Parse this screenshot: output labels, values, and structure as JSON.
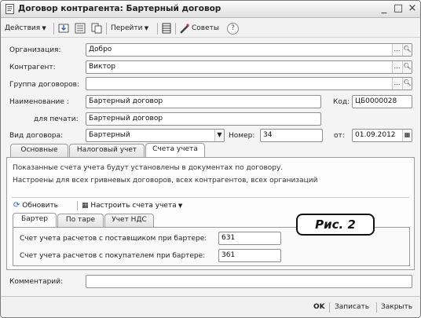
{
  "window": {
    "title": "Договор контрагента: Бартерный договор",
    "controls": {
      "minimize": "_",
      "maximize": "□",
      "close": "×"
    }
  },
  "toolbar": {
    "actions": "Действия",
    "goto": "Перейти",
    "advice": "Советы",
    "help": "?",
    "icons": [
      "save-down-icon",
      "list-icon",
      "copy-icon",
      "table-icon",
      "advice-icon",
      "help-icon"
    ]
  },
  "form": {
    "org_label": "Организация:",
    "org_value": "Добро",
    "contractor_label": "Контрагент:",
    "contractor_value": "Виктор",
    "group_label": "Группа договоров:",
    "group_value": "",
    "name_label": "Наименование :",
    "name_value": "Бартерный договор",
    "code_label": "Код:",
    "code_value": "ЦБ0000028",
    "print_label": "для печати:",
    "print_value": "Бартерный договор",
    "kind_label": "Вид договора:",
    "kind_value": "Бартерный",
    "number_label": "Номер:",
    "number_value": "34",
    "date_label": "от:",
    "date_value": "01.09.2012"
  },
  "tabs": [
    {
      "label": "Основные",
      "active": false
    },
    {
      "label": "Налоговый учет",
      "active": false
    },
    {
      "label": "Счета учета",
      "active": true
    }
  ],
  "accounts": {
    "info_line1": "Показанные счета учета будут установлены в документах по договору.",
    "info_line2": "Настроены для всех гривневых договоров, всех контрагентов, всех организаций",
    "refresh": "Обновить",
    "configure": "Настроить счета учета",
    "subtabs": [
      {
        "label": "Бартер",
        "active": true
      },
      {
        "label": "По таре",
        "active": false
      },
      {
        "label": "Учет НДС",
        "active": false
      }
    ],
    "supplier_label": "Счет учета расчетов с поставщиком при бартере:",
    "supplier_value": "631",
    "buyer_label": "Счет учета расчетов с покупателем при бартере:",
    "buyer_value": "361"
  },
  "callout": "Рис. 2",
  "comment": {
    "label": "Комментарий:",
    "value": ""
  },
  "footer": {
    "ok": "OK",
    "save": "Записать",
    "close": "Закрыть"
  },
  "colors": {
    "window_bg": "#f4f4f4",
    "field_border": "#8f8f8f",
    "tab_border": "#9a9a9a"
  }
}
